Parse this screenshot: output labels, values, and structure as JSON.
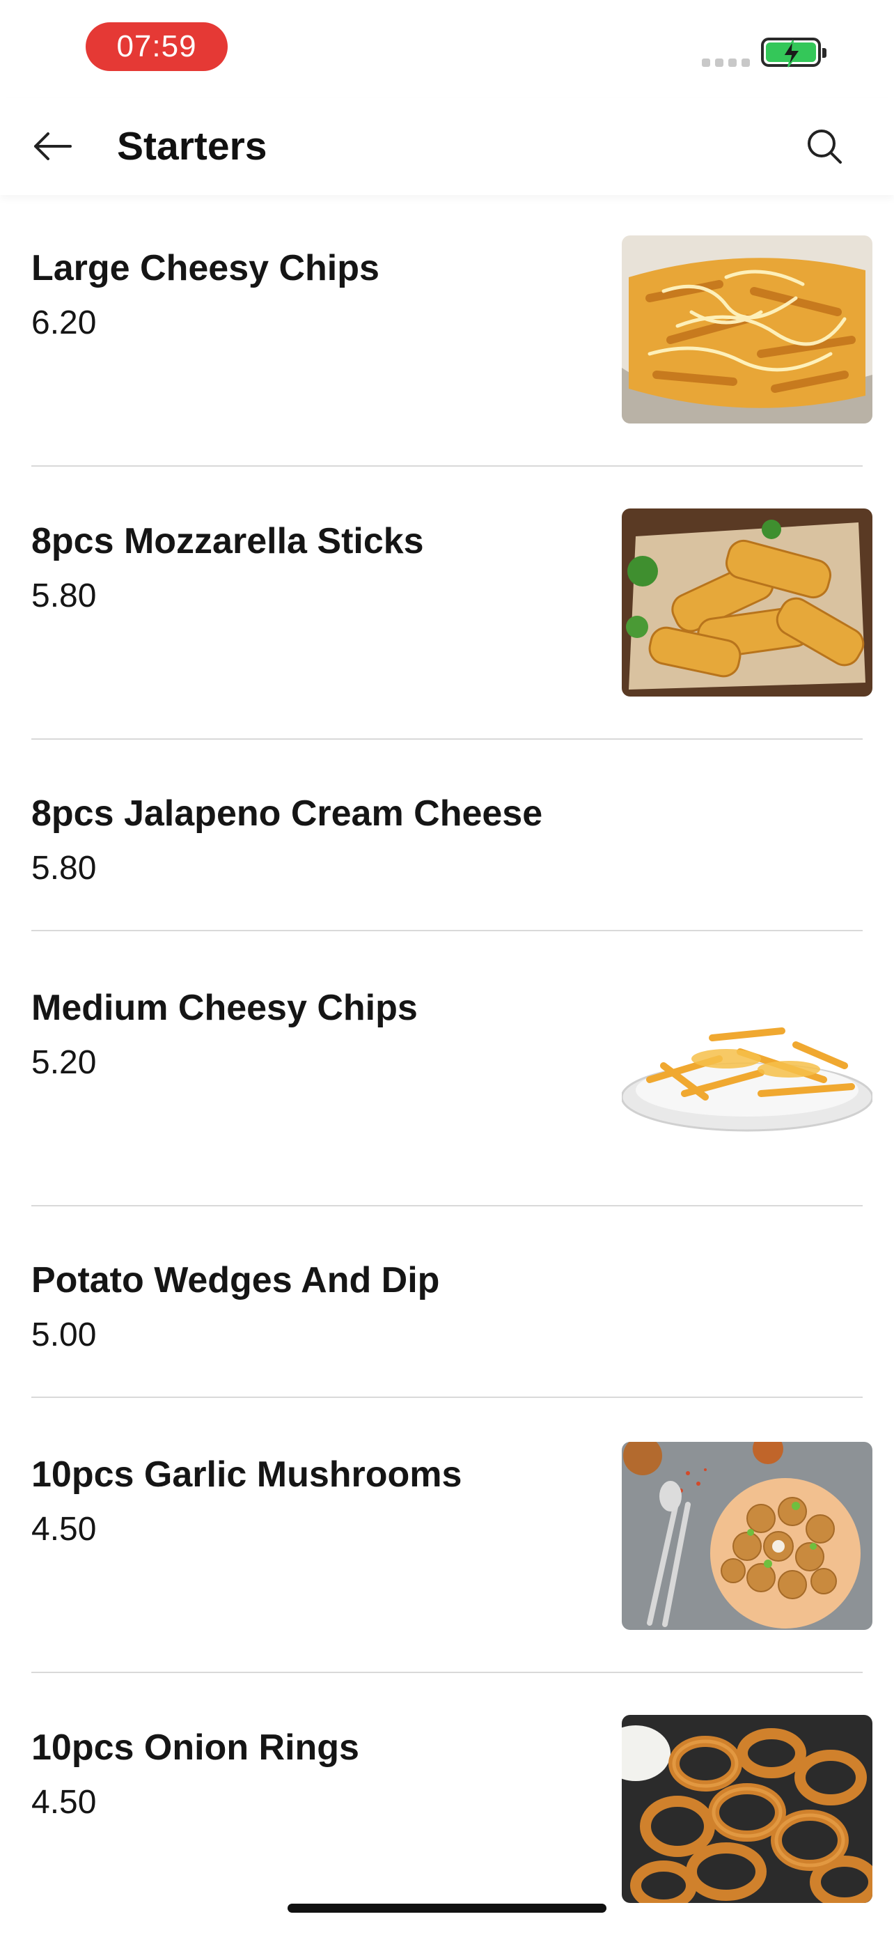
{
  "status_bar": {
    "time": "07:59",
    "time_pill_color": "#e53935",
    "battery_color": "#34c759"
  },
  "header": {
    "title": "Starters",
    "back_icon": "arrow-left-icon",
    "search_icon": "search-icon"
  },
  "items": [
    {
      "name": "Large Cheesy Chips",
      "price": "6.20",
      "image": "cheesy-chips-photo"
    },
    {
      "name": "8pcs Mozzarella Sticks",
      "price": "5.80",
      "image": "mozzarella-sticks-photo"
    },
    {
      "name": "8pcs Jalapeno Cream Cheese",
      "price": "5.80"
    },
    {
      "name": "Medium Cheesy Chips",
      "price": "5.20",
      "image": "cheesy-fries-plate-photo"
    },
    {
      "name": "Potato Wedges And Dip",
      "price": "5.00"
    },
    {
      "name": "10pcs Garlic Mushrooms",
      "price": "4.50",
      "image": "garlic-mushrooms-photo"
    },
    {
      "name": "10pcs Onion Rings",
      "price": "4.50",
      "image": "onion-rings-photo"
    }
  ]
}
